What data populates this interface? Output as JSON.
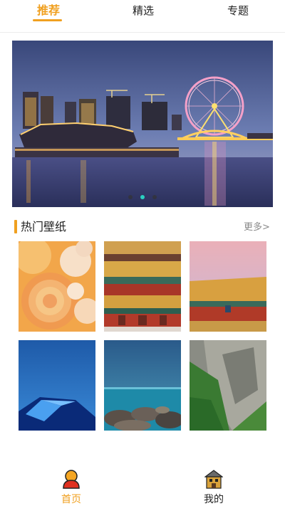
{
  "top_tabs": [
    {
      "label": "推荐",
      "active": true
    },
    {
      "label": "精选",
      "active": false
    },
    {
      "label": "专题",
      "active": false
    }
  ],
  "banner": {
    "image": "city-night-ferris-wheel",
    "active_slide": 2,
    "slide_count": 3
  },
  "hot_section": {
    "title": "热门壁纸",
    "more_label": "更多>"
  },
  "wallpapers": [
    {
      "image": "peach-rose-flowers"
    },
    {
      "image": "forbidden-city-palace-front"
    },
    {
      "image": "palace-roof-pink-sky"
    },
    {
      "image": "blue-tent-night"
    },
    {
      "image": "sea-rocks-coast"
    },
    {
      "image": "green-cliff-gorge"
    }
  ],
  "bottom_nav": [
    {
      "label": "首页",
      "icon": "person-icon",
      "active": true
    },
    {
      "label": "我的",
      "icon": "house-icon",
      "active": false
    }
  ],
  "colors": {
    "accent": "#f0a020",
    "active_dot": "#2ad0c0",
    "more_text": "#8a8a8a"
  }
}
